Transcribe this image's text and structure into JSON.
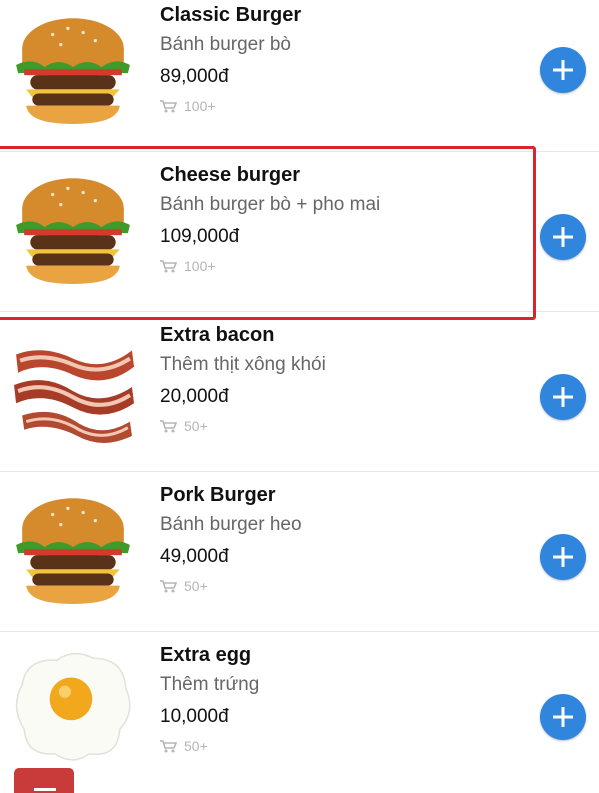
{
  "menu": {
    "items": [
      {
        "name": "Classic Burger",
        "description": "Bánh burger bò",
        "price": "89,000đ",
        "sold": "100+",
        "image": "burger",
        "selected": false
      },
      {
        "name": "Cheese burger",
        "description": "Bánh burger bò + pho mai",
        "price": "109,000đ",
        "sold": "100+",
        "image": "burger",
        "selected": true
      },
      {
        "name": "Extra bacon",
        "description": "Thêm thịt xông khói",
        "price": "20,000đ",
        "sold": "50+",
        "image": "bacon",
        "selected": false
      },
      {
        "name": "Pork Burger",
        "description": "Bánh burger heo",
        "price": "49,000đ",
        "sold": "50+",
        "image": "burger",
        "selected": false
      },
      {
        "name": "Extra egg",
        "description": "Thêm trứng",
        "price": "10,000đ",
        "sold": "50+",
        "image": "fried-egg",
        "selected": false
      }
    ]
  },
  "icons": {
    "sold": "shopping-cart-icon",
    "add": "plus-icon"
  },
  "colors": {
    "accent": "#2f86dc",
    "highlight": "#d8252b",
    "fab": "#c93a3a",
    "muted": "#b5b5b5"
  }
}
